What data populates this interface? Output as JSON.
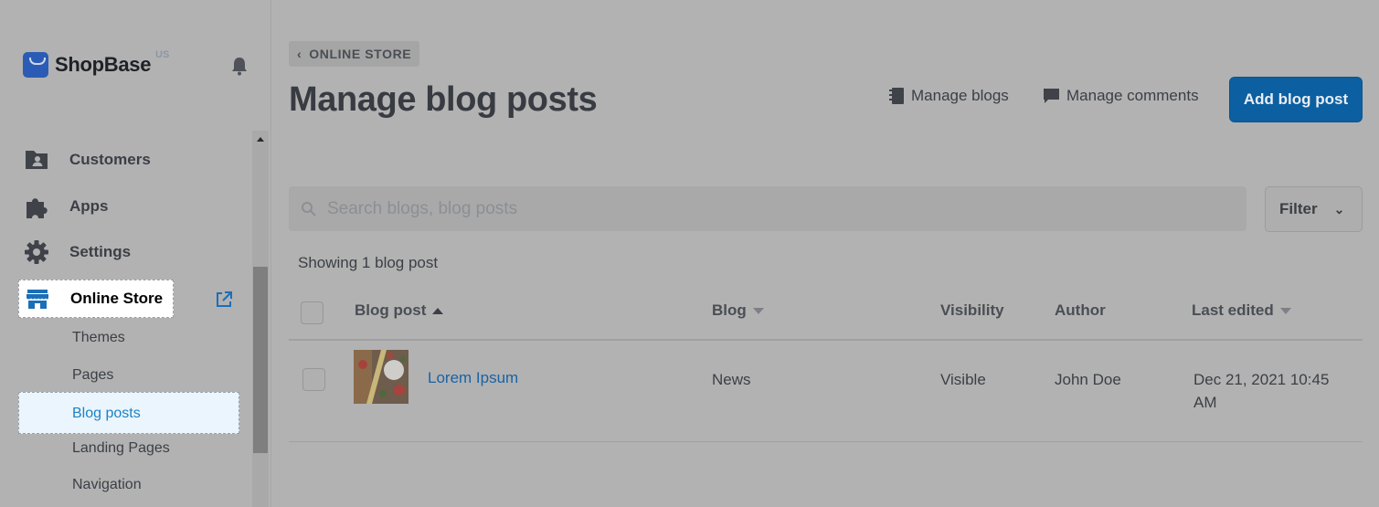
{
  "brand": {
    "name": "ShopBase",
    "region": "US"
  },
  "sidebar": {
    "items": [
      {
        "label": "Customers",
        "icon": "customers-icon"
      },
      {
        "label": "Apps",
        "icon": "puzzle-icon"
      },
      {
        "label": "Settings",
        "icon": "gear-icon"
      }
    ],
    "online_store": {
      "label": "Online Store",
      "icon": "store-icon"
    },
    "sub_items": [
      "Themes",
      "Pages",
      "Blog posts",
      "Landing Pages",
      "Navigation"
    ],
    "active_sub": "Blog posts"
  },
  "header": {
    "breadcrumb": "ONLINE STORE",
    "title": "Manage blog posts",
    "manage_blogs": "Manage blogs",
    "manage_comments": "Manage comments",
    "add_button": "Add blog post"
  },
  "search": {
    "placeholder": "Search blogs, blog posts"
  },
  "filter": {
    "label": "Filter"
  },
  "summary": "Showing 1 blog post",
  "table": {
    "columns": [
      "Blog post",
      "Blog",
      "Visibility",
      "Author",
      "Last edited"
    ],
    "rows": [
      {
        "title": "Lorem Ipsum",
        "blog": "News",
        "visibility": "Visible",
        "author": "John Doe",
        "last_edited_line1": "Dec 21, 2021 10:45",
        "last_edited_line2": "AM"
      }
    ]
  },
  "colors": {
    "accent": "#0c5fa1",
    "link": "#1b63a3",
    "active_bg": "#eaf5fd"
  }
}
